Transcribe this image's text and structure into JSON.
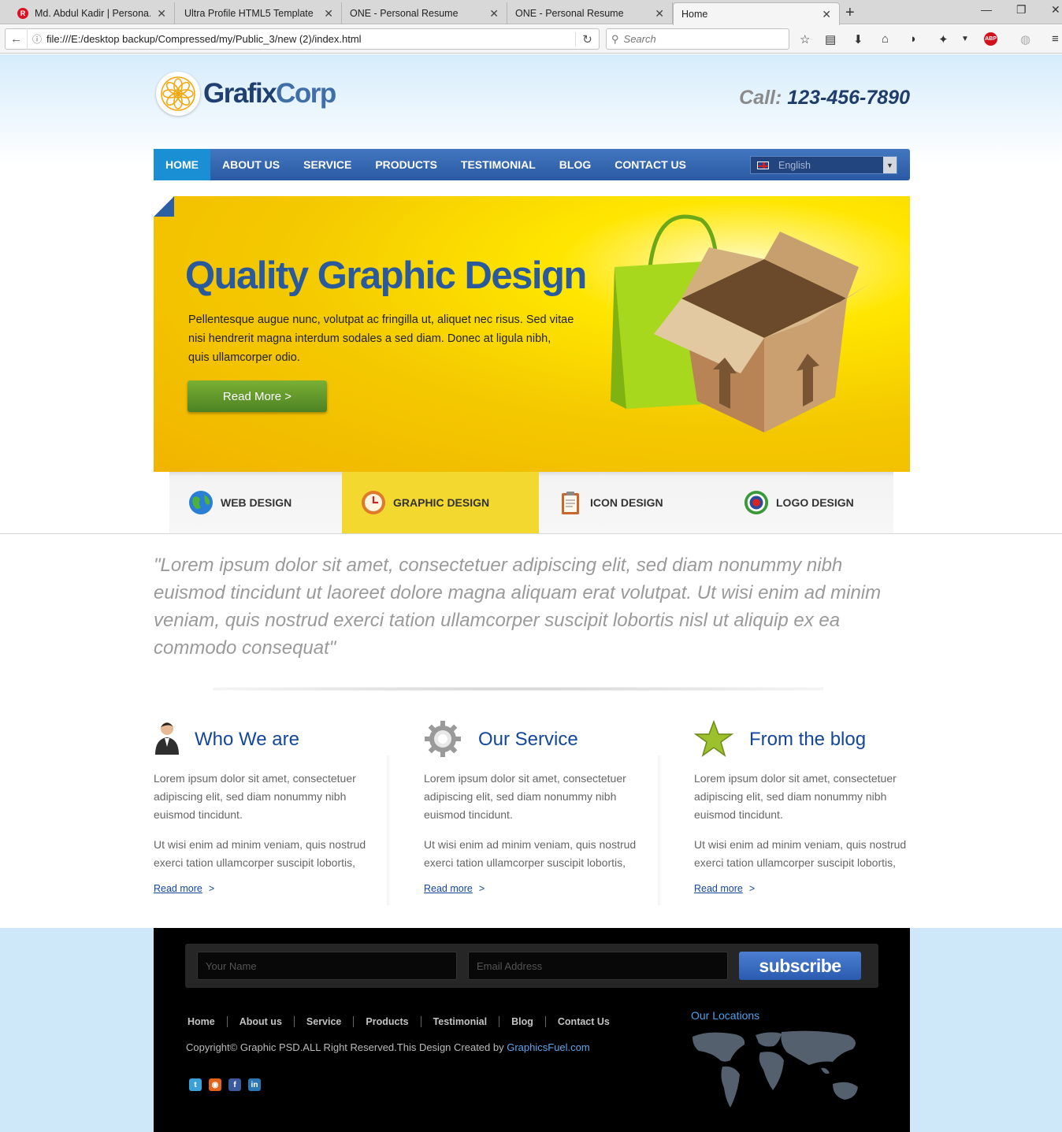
{
  "browser": {
    "tabs": [
      {
        "title": "Md. Abdul Kadir | Persona...",
        "active": false
      },
      {
        "title": "Ultra Profile HTML5 Template",
        "active": false
      },
      {
        "title": "ONE - Personal Resume",
        "active": false
      },
      {
        "title": "ONE - Personal Resume",
        "active": false
      },
      {
        "title": "Home",
        "active": true
      }
    ],
    "url": "file:///E:/desktop backup/Compressed/my/Public_3/new (2)/index.html",
    "search_placeholder": "Search"
  },
  "header": {
    "logo_part1": "Grafix",
    "logo_part2": "Corp",
    "phone_label": "Call:",
    "phone_number": "123-456-7890"
  },
  "nav": {
    "items": [
      "HOME",
      "ABOUT US",
      "SERVICE",
      "PRODUCTS",
      "TESTIMONIAL",
      "BLOG",
      "CONTACT US"
    ],
    "active": "HOME",
    "language": "English"
  },
  "hero": {
    "title": "Quality Graphic Design",
    "text": "Pellentesque augue nunc, volutpat ac fringilla ut, aliquet nec risus. Sed vitae nisi hendrerit magna interdum sodales a sed diam. Donec at ligula nibh, quis ullamcorper odio.",
    "button": "Read More  >"
  },
  "services": [
    {
      "label": "WEB DESIGN",
      "icon": "globe-icon",
      "active": false
    },
    {
      "label": "GRAPHIC DESIGN",
      "icon": "clock-icon",
      "active": true
    },
    {
      "label": "ICON DESIGN",
      "icon": "clipboard-icon",
      "active": false
    },
    {
      "label": "LOGO DESIGN",
      "icon": "target-icon",
      "active": false
    }
  ],
  "quote": "\"Lorem ipsum dolor sit amet, consectetuer adipiscing elit, sed diam nonummy nibh euismod tincidunt ut laoreet dolore magna aliquam erat volutpat. Ut wisi enim ad minim veniam, quis nostrud exerci tation ullamcorper suscipit lobortis nisl ut aliquip ex ea commodo consequat\"",
  "columns": [
    {
      "title": "Who We are",
      "icon": "person-icon",
      "p1": "Lorem ipsum dolor sit amet, consectetuer adipiscing elit, sed diam nonummy nibh euismod tincidunt.",
      "p2": "Ut wisi enim ad minim veniam, quis nostrud exerci tation ullamcorper suscipit lobortis,",
      "link": "Read more",
      "link_arrow": ">"
    },
    {
      "title": "Our Service",
      "icon": "gear-icon",
      "p1": "Lorem ipsum dolor sit amet, consectetuer adipiscing elit, sed diam nonummy nibh euismod tincidunt.",
      "p2": "Ut wisi enim ad minim veniam, quis nostrud exerci tation ullamcorper suscipit lobortis,",
      "link": "Read more",
      "link_arrow": ">"
    },
    {
      "title": "From the blog",
      "icon": "star-icon",
      "p1": "Lorem ipsum dolor sit amet, consectetuer adipiscing elit, sed diam nonummy nibh euismod tincidunt.",
      "p2": "Ut wisi enim ad minim veniam, quis nostrud exerci tation ullamcorper suscipit lobortis,",
      "link": "Read more",
      "link_arrow": ">"
    }
  ],
  "footer": {
    "name_placeholder": "Your Name",
    "email_placeholder": "Email Address",
    "subscribe": "subscribe",
    "nav": [
      "Home",
      "About us",
      "Service",
      "Products",
      "Testimonial",
      "Blog",
      "Contact Us"
    ],
    "copyright": "Copyright© Graphic PSD.ALL Right Reserved.This Design Created by",
    "copyright_link": "GraphicsFuel.com",
    "social": [
      "twitter-icon",
      "rss-icon",
      "facebook-icon",
      "linkedin-icon"
    ],
    "locations_title": "Our Locations"
  },
  "colors": {
    "nav_blue": "#2a5aa3",
    "nav_active": "#1a8fd3",
    "hero_yellow": "#f4c900",
    "link_blue": "#13479d",
    "button_green": "#5a9129",
    "service_active": "#f2d82f"
  }
}
